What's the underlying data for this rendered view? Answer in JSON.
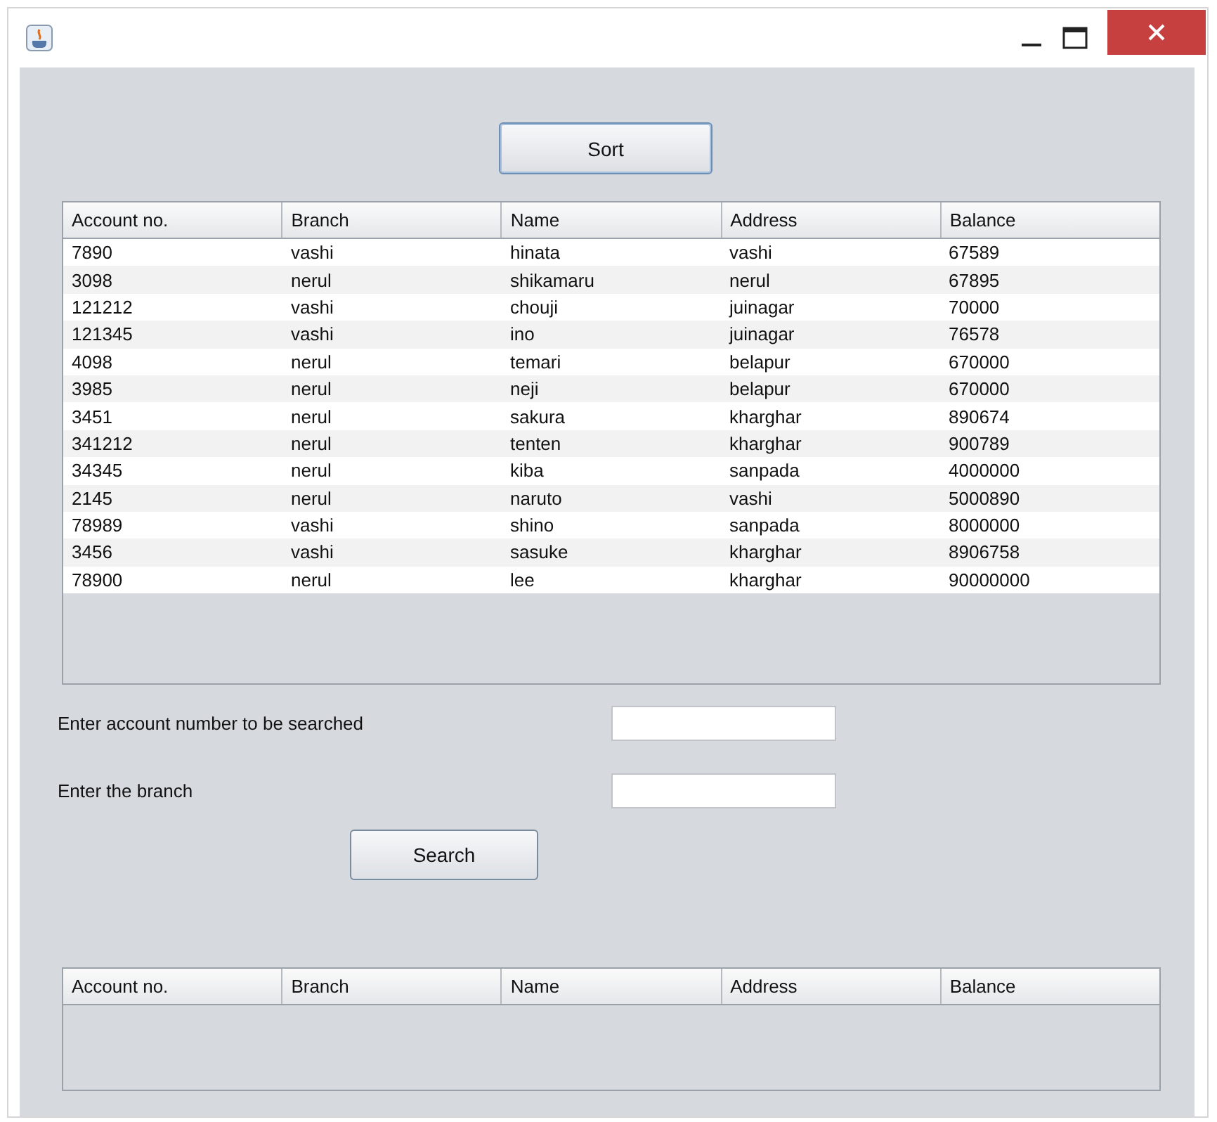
{
  "sort_button": "Sort",
  "table": {
    "columns": [
      "Account no.",
      "Branch",
      "Name",
      "Address",
      "Balance"
    ],
    "rows": [
      [
        "7890",
        "vashi",
        "hinata",
        "vashi",
        "67589"
      ],
      [
        "3098",
        "nerul",
        "shikamaru",
        "nerul",
        "67895"
      ],
      [
        "121212",
        "vashi",
        "chouji",
        "juinagar",
        "70000"
      ],
      [
        "121345",
        "vashi",
        "ino",
        "juinagar",
        "76578"
      ],
      [
        "4098",
        "nerul",
        "temari",
        "belapur",
        "670000"
      ],
      [
        "3985",
        "nerul",
        "neji",
        "belapur",
        "670000"
      ],
      [
        "3451",
        "nerul",
        "sakura",
        "kharghar",
        "890674"
      ],
      [
        "341212",
        "nerul",
        "tenten",
        "kharghar",
        "900789"
      ],
      [
        "34345",
        "nerul",
        "kiba",
        "sanpada",
        "4000000"
      ],
      [
        "2145",
        "nerul",
        "naruto",
        "vashi",
        "5000890"
      ],
      [
        "78989",
        "vashi",
        "shino",
        "sanpada",
        "8000000"
      ],
      [
        "3456",
        "vashi",
        "sasuke",
        "kharghar",
        "8906758"
      ],
      [
        "78900",
        "nerul",
        "lee",
        "kharghar",
        "90000000"
      ]
    ]
  },
  "search_form": {
    "fields": [
      {
        "label": "Enter account number to be searched"
      },
      {
        "label": "Enter the branch"
      }
    ],
    "button": "Search"
  },
  "result_table": {
    "columns": [
      "Account no.",
      "Branch",
      "Name",
      "Address",
      "Balance"
    ]
  }
}
